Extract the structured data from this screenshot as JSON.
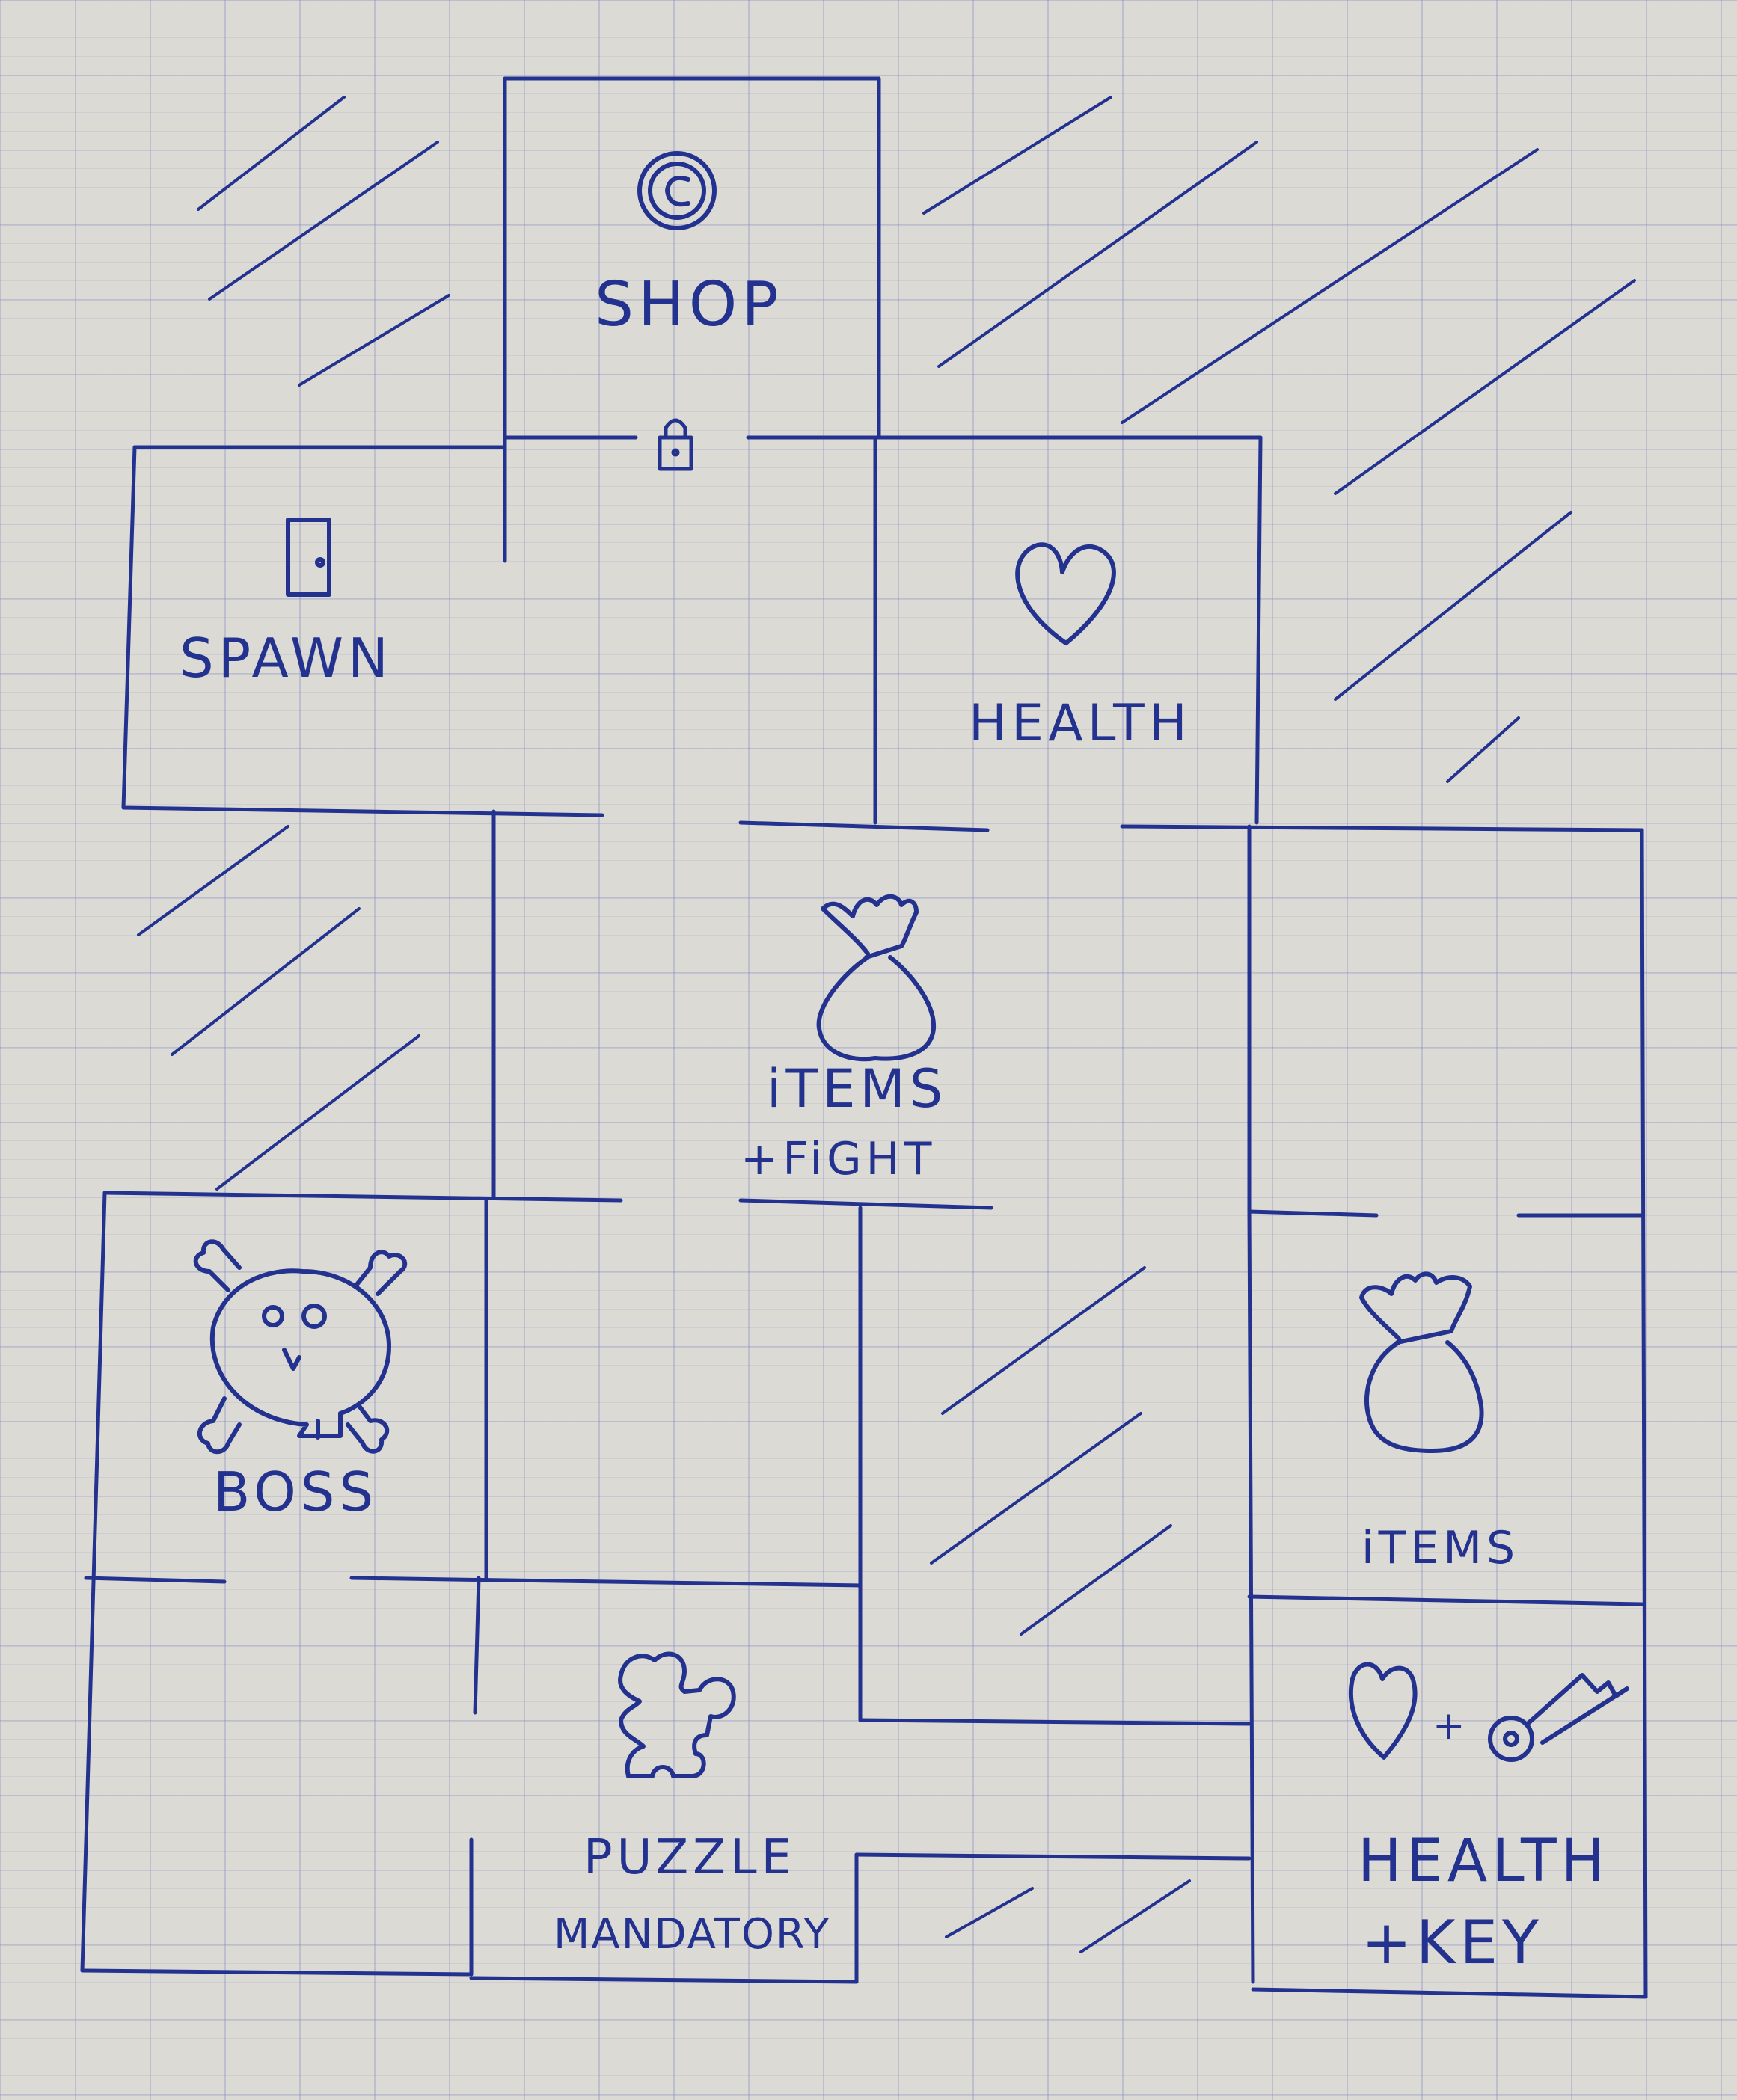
{
  "rooms": {
    "shop": "SHOP",
    "spawn": "SPAWN",
    "health": "HEALTH",
    "items_fight_line1": "iTEMS",
    "items_fight_line2": "+FiGHT",
    "boss": "BOSS",
    "items": "iTEMS",
    "puzzle_line1": "PUZZLE",
    "puzzle_line2": "MANDATORY",
    "health_key_line1": "HEALTH",
    "health_key_line2": "+KEY"
  },
  "icons": {
    "shop": "coin-icon",
    "shop_entrance": "padlock-icon",
    "spawn": "door-icon",
    "health": "heart-icon",
    "items_fight": "loot-bag-icon",
    "boss": "skull-crossbones-icon",
    "items": "loot-bag-icon",
    "puzzle": "puzzle-piece-icon",
    "health_key": [
      "heart-icon",
      "key-icon"
    ]
  },
  "symbols": {
    "plus": "+"
  },
  "colors": {
    "ink": "#23328f",
    "paper": "#dcdad5",
    "grid": "#8a93c8"
  }
}
